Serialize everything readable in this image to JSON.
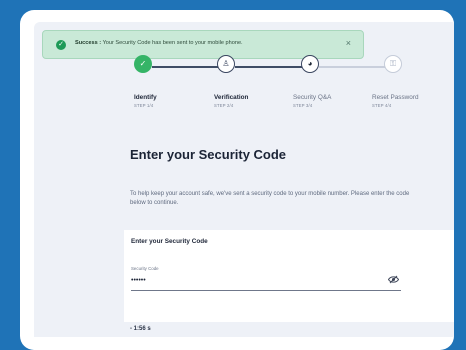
{
  "toast": {
    "strong": "Success :",
    "text": "Your Security Code has been sent to your mobile phone.",
    "close_glyph": "×",
    "icon": "check-icon"
  },
  "steps": [
    {
      "name": "Identify",
      "sub": "STEP 1/4",
      "state": "done",
      "icon": "check-icon",
      "glyph": "✓"
    },
    {
      "name": "Verification",
      "sub": "STEP 2/4",
      "state": "current",
      "icon": "user-icon",
      "glyph": "♙"
    },
    {
      "name": "Security Q&A",
      "sub": "STEP 3/4",
      "state": "pending",
      "icon": "shield-icon",
      "glyph": "◕"
    },
    {
      "name": "Reset Password",
      "sub": "STEP 4/4",
      "state": "pending",
      "icon": "key-icon",
      "glyph": "⚿"
    }
  ],
  "main": {
    "title": "Enter your Security Code",
    "description": "To help keep your account safe, we've sent a security code to your mobile number. Please enter the code below to continue."
  },
  "form": {
    "card_title": "Enter your Security Code",
    "field_label": "Security Code",
    "field_value": "••••••",
    "eye_icon": "eye-off-icon"
  },
  "timer": {
    "text": "- 1:56 s"
  }
}
